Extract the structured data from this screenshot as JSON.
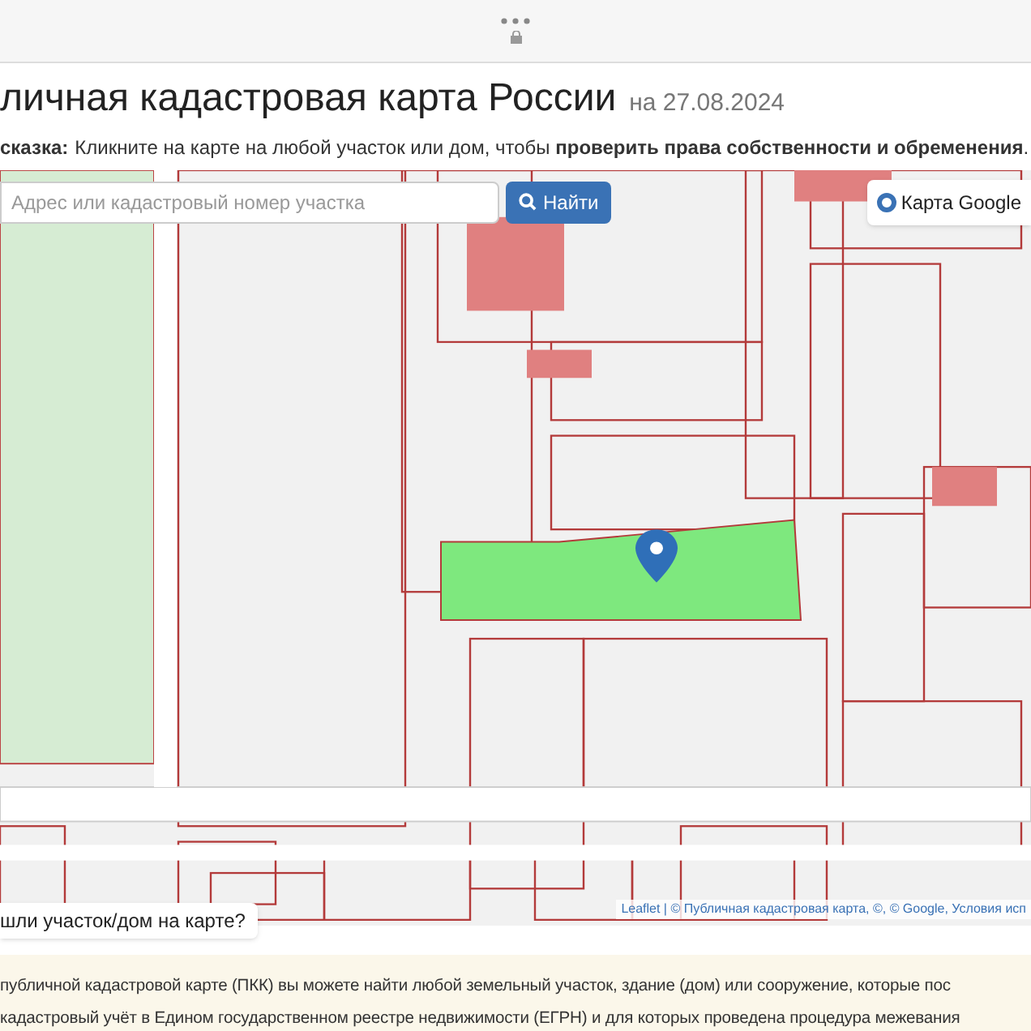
{
  "heading": {
    "title": "личная кадастровая карта России",
    "date": "на 27.08.2024"
  },
  "hint": {
    "label": "сказка:",
    "text": "Кликните на карте на любой участок или дом, чтобы **проверить права собственности и обременения**."
  },
  "map": {
    "search": {
      "placeholder": "Адрес или кадастровый номер участка"
    },
    "search_button": "Найти",
    "layer_switch": {
      "label": "Карта Google",
      "selected": true
    },
    "help_button": "шли участок/дом на карте?",
    "attribution": "Leaflet | © Публичная кадастровая карта, ©, © Google, Условия исп"
  },
  "info": {
    "lines": [
      "публичной кадастровой карте (ПКК) вы можете найти любой земельный участок, здание (дом) или сооружение, которые пос",
      "кадастровый учёт в Едином государственном реестре недвижимости (ЕГРН) и для которых проведена процедура межевания"
    ]
  }
}
